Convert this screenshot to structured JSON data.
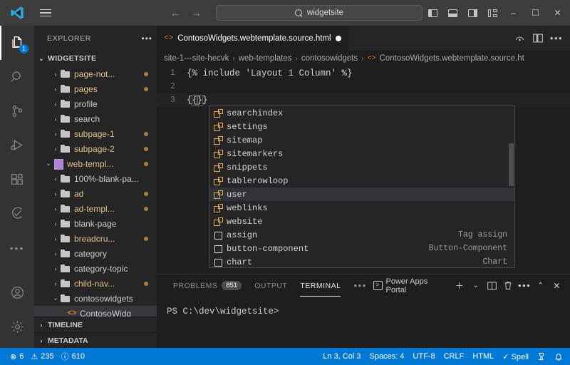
{
  "titlebar": {
    "logo_icon": "vscode-logo-icon",
    "menu_icon": "hamburger-menu-icon",
    "back_icon": "←",
    "forward_icon": "→",
    "search": {
      "icon": "search-icon",
      "value": "widgetsite",
      "placeholder": "Search"
    },
    "layout_buttons": [
      {
        "name": "toggle-primary-sidebar",
        "icon": "layout-sidebar-left-icon"
      },
      {
        "name": "toggle-panel",
        "icon": "layout-panel-bottom-icon"
      },
      {
        "name": "toggle-secondary-sidebar",
        "icon": "layout-sidebar-right-icon"
      },
      {
        "name": "customize-layout",
        "icon": "layout-grid-icon"
      }
    ],
    "window_controls": {
      "minimize": "–",
      "maximize": "☐",
      "close": "✕"
    }
  },
  "activitybar": {
    "items": [
      {
        "name": "explorer",
        "icon": "files-icon",
        "active": true,
        "badge": "1"
      },
      {
        "name": "search",
        "icon": "search-icon",
        "active": false,
        "badge": ""
      },
      {
        "name": "source-control",
        "icon": "source-control-icon",
        "active": false,
        "badge": ""
      },
      {
        "name": "run-and-debug",
        "icon": "run-debug-icon",
        "active": false,
        "badge": ""
      },
      {
        "name": "extensions",
        "icon": "extensions-icon",
        "active": false,
        "badge": ""
      },
      {
        "name": "testing",
        "icon": "beaker-check-icon",
        "active": false,
        "badge": ""
      },
      {
        "name": "more-views",
        "icon": "ellipsis-icon",
        "active": false,
        "badge": ""
      }
    ],
    "bottom_items": [
      {
        "name": "accounts",
        "icon": "account-icon"
      },
      {
        "name": "manage-settings",
        "icon": "gear-icon"
      }
    ]
  },
  "sidebar": {
    "title": "EXPLORER",
    "more_actions_icon": "ellipsis-icon",
    "root": {
      "label": "WIDGETSITE",
      "expanded": true
    },
    "tree": [
      {
        "label": "page-not...",
        "type": "folder",
        "expanded": false,
        "modified": true,
        "indent": 2
      },
      {
        "label": "pages",
        "type": "folder",
        "expanded": false,
        "modified": true,
        "indent": 2
      },
      {
        "label": "profile",
        "type": "folder",
        "expanded": false,
        "modified": false,
        "indent": 2
      },
      {
        "label": "search",
        "type": "folder",
        "expanded": false,
        "modified": false,
        "indent": 2
      },
      {
        "label": "subpage-1",
        "type": "folder",
        "expanded": false,
        "modified": true,
        "indent": 2
      },
      {
        "label": "subpage-2",
        "type": "folder",
        "expanded": false,
        "modified": true,
        "indent": 2
      },
      {
        "label": "web-templ...",
        "type": "template",
        "expanded": true,
        "modified": true,
        "indent": 1
      },
      {
        "label": "100%-blank-pa...",
        "type": "folder",
        "expanded": false,
        "modified": false,
        "indent": 2
      },
      {
        "label": "ad",
        "type": "folder",
        "expanded": false,
        "modified": true,
        "indent": 2
      },
      {
        "label": "ad-templ...",
        "type": "folder",
        "expanded": false,
        "modified": true,
        "indent": 2
      },
      {
        "label": "blank-page",
        "type": "folder",
        "expanded": false,
        "modified": false,
        "indent": 2
      },
      {
        "label": "breadcru...",
        "type": "folder",
        "expanded": false,
        "modified": true,
        "indent": 2
      },
      {
        "label": "category",
        "type": "folder",
        "expanded": false,
        "modified": false,
        "indent": 2
      },
      {
        "label": "category-topic",
        "type": "folder",
        "expanded": false,
        "modified": false,
        "indent": 2
      },
      {
        "label": "child-nav...",
        "type": "folder",
        "expanded": false,
        "modified": true,
        "indent": 2
      },
      {
        "label": "contosowidgets",
        "type": "folder",
        "expanded": true,
        "modified": false,
        "indent": 2
      },
      {
        "label": "ContosoWidg",
        "type": "html",
        "expanded": null,
        "modified": false,
        "indent": 3,
        "selected": true
      }
    ],
    "bottom_sections": [
      {
        "label": "TIMELINE",
        "expanded": false
      },
      {
        "label": "METADATA",
        "expanded": false
      }
    ]
  },
  "editor": {
    "tab": {
      "icon": "html-file-icon",
      "label": "ContosoWidgets.webtemplate.source.html",
      "dirty_icon": "unsaved-dot-icon"
    },
    "tab_actions": [
      {
        "name": "split-editor-progress",
        "icon": "gauge-icon"
      },
      {
        "name": "split-editor-right",
        "icon": "split-editor-icon"
      },
      {
        "name": "more-editor-actions",
        "icon": "ellipsis-icon"
      }
    ],
    "breadcrumbs": [
      "site-1---site-hecvk",
      "web-templates",
      "contosowidgets",
      "ContosoWidgets.webtemplate.source.ht"
    ],
    "breadcrumb_file_icon": "html-file-icon",
    "lines": [
      {
        "num": "1",
        "text": "{% include 'Layout 1 Column' %}"
      },
      {
        "num": "2",
        "text": ""
      },
      {
        "num": "3",
        "text": "{{}}",
        "current": true
      }
    ]
  },
  "suggest": {
    "items": [
      {
        "label": "searchindex",
        "icon": "object-icon",
        "detail": "",
        "selected": false
      },
      {
        "label": "settings",
        "icon": "object-icon",
        "detail": "",
        "selected": false
      },
      {
        "label": "sitemap",
        "icon": "object-icon",
        "detail": "",
        "selected": false
      },
      {
        "label": "sitemarkers",
        "icon": "object-icon",
        "detail": "",
        "selected": false
      },
      {
        "label": "snippets",
        "icon": "object-icon",
        "detail": "",
        "selected": false
      },
      {
        "label": "tablerowloop",
        "icon": "object-icon",
        "detail": "",
        "selected": false
      },
      {
        "label": "user",
        "icon": "object-icon",
        "detail": "",
        "selected": true
      },
      {
        "label": "weblinks",
        "icon": "object-icon",
        "detail": "",
        "selected": false
      },
      {
        "label": "website",
        "icon": "object-icon",
        "detail": "",
        "selected": false
      },
      {
        "label": "assign",
        "icon": "keyword-icon",
        "detail": "Tag assign",
        "selected": false
      },
      {
        "label": "button-component",
        "icon": "keyword-icon",
        "detail": "Button-Component",
        "selected": false
      },
      {
        "label": "chart",
        "icon": "keyword-icon",
        "detail": "Chart",
        "selected": false
      }
    ]
  },
  "panel": {
    "tabs": [
      {
        "label": "PROBLEMS",
        "count": "851",
        "active": false
      },
      {
        "label": "OUTPUT",
        "count": "",
        "active": false
      },
      {
        "label": "TERMINAL",
        "count": "",
        "active": true
      }
    ],
    "more_tabs_icon": "ellipsis-icon",
    "terminal_selector": {
      "icon": "terminal-icon",
      "label": "Power Apps Portal"
    },
    "actions": [
      {
        "name": "new-terminal",
        "icon": "plus-icon"
      },
      {
        "name": "terminal-dropdown",
        "icon": "chevron-down-icon"
      },
      {
        "name": "split-terminal",
        "icon": "split-icon"
      },
      {
        "name": "kill-terminal",
        "icon": "trash-icon"
      },
      {
        "name": "panel-more-actions",
        "icon": "ellipsis-icon"
      },
      {
        "name": "maximize-panel",
        "icon": "chevron-up-icon"
      },
      {
        "name": "close-panel",
        "icon": "close-icon"
      }
    ],
    "terminal_prompt": "PS C:\\dev\\widgetsite>"
  },
  "statusbar": {
    "left": [
      {
        "name": "errors",
        "icon": "error-icon",
        "text": "6"
      },
      {
        "name": "warnings",
        "icon": "warning-icon",
        "text": "235"
      },
      {
        "name": "info",
        "icon": "info-icon",
        "text": "610"
      }
    ],
    "right": [
      {
        "name": "cursor-position",
        "text": "Ln 3, Col 3"
      },
      {
        "name": "indentation",
        "text": "Spaces: 4"
      },
      {
        "name": "encoding",
        "text": "UTF-8"
      },
      {
        "name": "eol",
        "text": "CRLF"
      },
      {
        "name": "language-mode",
        "text": "HTML"
      },
      {
        "name": "spell-checker",
        "text": "✓ Spell"
      },
      {
        "name": "remote-indicator",
        "text": ""
      },
      {
        "name": "notifications",
        "text": ""
      }
    ],
    "accent_color": "#0078d4"
  }
}
